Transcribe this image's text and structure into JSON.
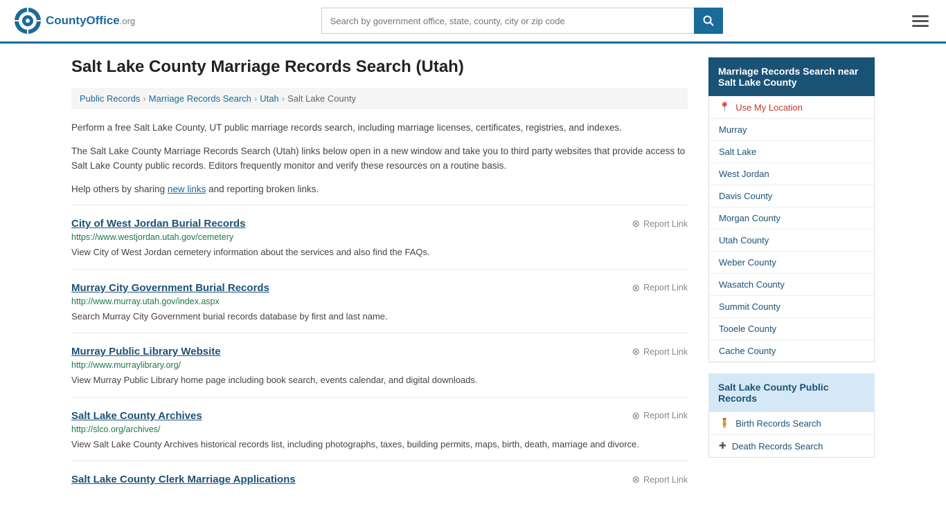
{
  "header": {
    "logo_text": "CountyOffice",
    "logo_suffix": ".org",
    "search_placeholder": "Search by government office, state, county, city or zip code",
    "search_value": ""
  },
  "page": {
    "title": "Salt Lake County Marriage Records Search (Utah)",
    "breadcrumb": [
      {
        "label": "Public Records",
        "href": "#"
      },
      {
        "label": "Marriage Records Search",
        "href": "#"
      },
      {
        "label": "Utah",
        "href": "#"
      },
      {
        "label": "Salt Lake County",
        "href": "#"
      }
    ],
    "description1": "Perform a free Salt Lake County, UT public marriage records search, including marriage licenses, certificates, registries, and indexes.",
    "description2": "The Salt Lake County Marriage Records Search (Utah) links below open in a new window and take you to third party websites that provide access to Salt Lake County public records. Editors frequently monitor and verify these resources on a routine basis.",
    "description3_prefix": "Help others by sharing ",
    "description3_link": "new links",
    "description3_suffix": " and reporting broken links."
  },
  "results": [
    {
      "title": "City of West Jordan Burial Records",
      "url": "https://www.westjordan.utah.gov/cemetery",
      "description": "View City of West Jordan cemetery information about the services and also find the FAQs.",
      "report_label": "Report Link"
    },
    {
      "title": "Murray City Government Burial Records",
      "url": "http://www.murray.utah.gov/index.aspx",
      "description": "Search Murray City Government burial records database by first and last name.",
      "report_label": "Report Link"
    },
    {
      "title": "Murray Public Library Website",
      "url": "http://www.murraylibrary.org/",
      "description": "View Murray Public Library home page including book search, events calendar, and digital downloads.",
      "report_label": "Report Link"
    },
    {
      "title": "Salt Lake County Archives",
      "url": "http://slco.org/archives/",
      "description": "View Salt Lake County Archives historical records list, including photographs, taxes, building permits, maps, birth, death, marriage and divorce.",
      "report_label": "Report Link"
    },
    {
      "title": "Salt Lake County Clerk Marriage Applications",
      "url": "",
      "description": "",
      "report_label": "Report Link"
    }
  ],
  "sidebar": {
    "nearby_section_title": "Marriage Records Search near Salt Lake County",
    "use_location_label": "Use My Location",
    "nearby_items": [
      {
        "label": "Murray"
      },
      {
        "label": "Salt Lake"
      },
      {
        "label": "West Jordan"
      },
      {
        "label": "Davis County"
      },
      {
        "label": "Morgan County"
      },
      {
        "label": "Utah County"
      },
      {
        "label": "Weber County"
      },
      {
        "label": "Wasatch County"
      },
      {
        "label": "Summit County"
      },
      {
        "label": "Tooele County"
      },
      {
        "label": "Cache County"
      }
    ],
    "public_records_section_title": "Salt Lake County Public Records",
    "public_records_items": [
      {
        "label": "Birth Records Search",
        "icon": "person"
      },
      {
        "label": "Death Records Search",
        "icon": "cross"
      }
    ]
  }
}
